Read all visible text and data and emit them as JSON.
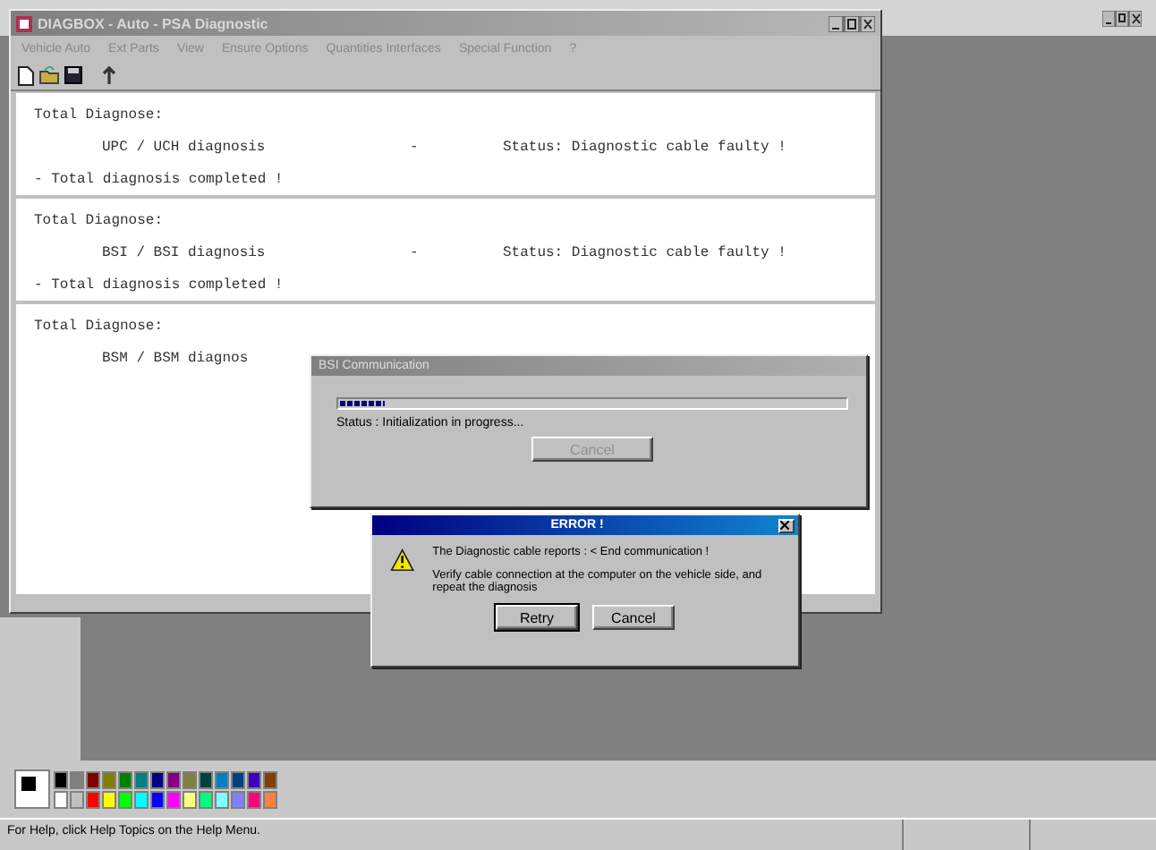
{
  "background_window": {
    "status_bar": "For Help, click Help Topics on the Help Menu.",
    "palette": [
      {
        "color": "#000000"
      },
      {
        "color": "#808080"
      },
      {
        "color": "#800000"
      },
      {
        "color": "#808000"
      },
      {
        "color": "#008000"
      },
      {
        "color": "#008080"
      },
      {
        "color": "#000080"
      },
      {
        "color": "#800080"
      },
      {
        "color": "#808040"
      },
      {
        "color": "#004040"
      },
      {
        "color": "#0080c0"
      },
      {
        "color": "#004080"
      },
      {
        "color": "#4000c0"
      },
      {
        "color": "#804000"
      },
      {
        "color": "#ffffff"
      },
      {
        "color": "#c0c0c0"
      },
      {
        "color": "#ff0000"
      },
      {
        "color": "#ffff00"
      },
      {
        "color": "#00ff00"
      },
      {
        "color": "#00ffff"
      },
      {
        "color": "#0000ff"
      },
      {
        "color": "#ff00ff"
      },
      {
        "color": "#ffff80"
      },
      {
        "color": "#00ff80"
      },
      {
        "color": "#80ffff"
      },
      {
        "color": "#8080ff"
      },
      {
        "color": "#ff0080"
      },
      {
        "color": "#ff8040"
      }
    ]
  },
  "app_window": {
    "title": "DIAGBOX - Auto - PSA Diagnostic",
    "menu": [
      "Vehicle Auto",
      "Ext Parts",
      "View",
      "Ensure Options",
      "Quantities Interfaces",
      "Special Function",
      "?"
    ],
    "sections": [
      {
        "heading": "Total Diagnose:",
        "ecu": "UPC / UCH diagnosis",
        "separator": "-",
        "status": "Status: Diagnostic cable faulty !",
        "footer": "- Total diagnosis completed !"
      },
      {
        "heading": "Total Diagnose:",
        "ecu": "BSI / BSI diagnosis",
        "separator": "-",
        "status": "Status: Diagnostic cable faulty !",
        "footer": "- Total diagnosis completed !"
      },
      {
        "heading": "Total Diagnose:",
        "ecu": "BSM / BSM diagnos"
      }
    ]
  },
  "progress_dialog": {
    "title": "BSI Communication",
    "level": 0.09,
    "status": "Status : Initialization in progress...",
    "button": {
      "label": "Cancel",
      "disabled": true
    }
  },
  "error_dialog": {
    "title": "ERROR !",
    "message": "The Diagnostic cable reports : < End communication !",
    "detail": "Verify cable connection at the computer on the vehicle side, and repeat the diagnosis",
    "buttons": [
      {
        "label": "Retry",
        "default": true
      },
      {
        "label": "Cancel",
        "default": false
      }
    ]
  }
}
